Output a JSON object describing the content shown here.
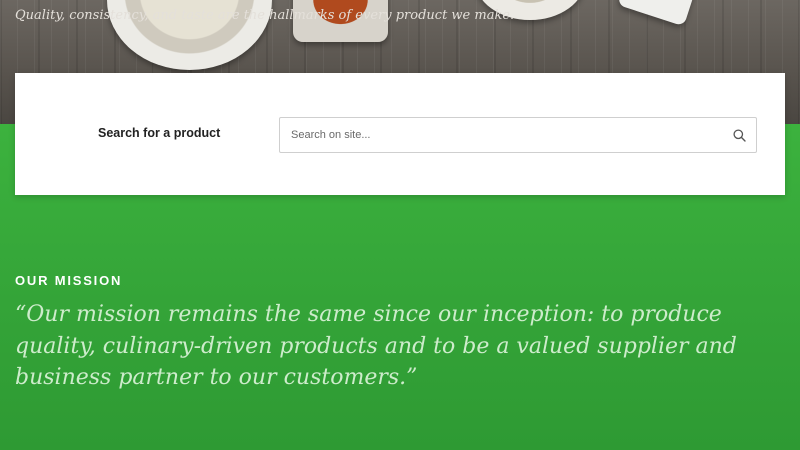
{
  "hero": {
    "tagline": "Quality, consistency, and taste are the hallmarks of every product we make."
  },
  "search": {
    "label": "Search for a product",
    "placeholder": "Search on site...",
    "icon": "search-icon"
  },
  "mission": {
    "heading": "OUR MISSION",
    "quote": "“Our mission remains the same since our inception: to produce quality, culinary-driven products and to be a valued supplier and business partner to our customers.”"
  },
  "colors": {
    "green": "#34a438",
    "quote_text": "#cdeccb",
    "wood": "#5e5953"
  }
}
